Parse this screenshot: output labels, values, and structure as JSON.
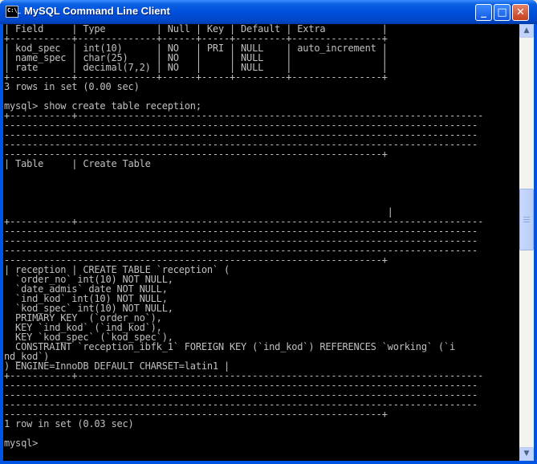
{
  "window": {
    "title": "MySQL Command Line Client",
    "icon_name": "console-app-icon",
    "icon_text": "C:\\_"
  },
  "controls": {
    "minimize": "_",
    "maximize": "□",
    "close": "✕"
  },
  "scrollbar": {
    "up": "▲",
    "down": "▼"
  },
  "colors": {
    "titlebar": "#0054e3",
    "console_bg": "#000000",
    "console_text": "#c0c0c0"
  },
  "console": {
    "lines": [
      "| Field     | Type         | Null | Key | Default | Extra          |",
      "+-----------+--------------+------+-----+---------+----------------+",
      "| kod_spec  | int(10)      | NO   | PRI | NULL    | auto_increment |",
      "| name_spec | char(25)     | NO   |     | NULL    |                |",
      "| rate      | decimal(7,2) | NO   |     | NULL    |                |",
      "+-----------+--------------+------+-----+---------+----------------+",
      "3 rows in set (0.00 sec)",
      "",
      "mysql> show create table reception;",
      "+-----------+------------------------------------------------------------------------",
      "------------------------------------------------------------------------------------",
      "------------------------------------------------------------------------------------",
      "------------------------------------------------------------------------------------",
      "-------------------------------------------------------------------+",
      "| Table     | Create Table",
      "",
      "",
      "",
      "",
      "                                                                    |",
      "+-----------+------------------------------------------------------------------------",
      "------------------------------------------------------------------------------------",
      "------------------------------------------------------------------------------------",
      "------------------------------------------------------------------------------------",
      "-------------------------------------------------------------------+",
      "| reception | CREATE TABLE `reception` (",
      "  `order_no` int(10) NOT NULL,",
      "  `date_admis` date NOT NULL,",
      "  `ind_kod` int(10) NOT NULL,",
      "  `kod_spec` int(10) NOT NULL,",
      "  PRIMARY KEY  (`order_no`),",
      "  KEY `ind_kod` (`ind_kod`),",
      "  KEY `kod_spec` (`kod_spec`),",
      "  CONSTRAINT `reception_ibfk_1` FOREIGN KEY (`ind_kod`) REFERENCES `working` (`i",
      "nd_kod`)",
      ") ENGINE=InnoDB DEFAULT CHARSET=latin1 |",
      "+-----------+------------------------------------------------------------------------",
      "------------------------------------------------------------------------------------",
      "------------------------------------------------------------------------------------",
      "------------------------------------------------------------------------------------",
      "-------------------------------------------------------------------+",
      "1 row in set (0.03 sec)",
      "",
      "mysql>"
    ]
  }
}
